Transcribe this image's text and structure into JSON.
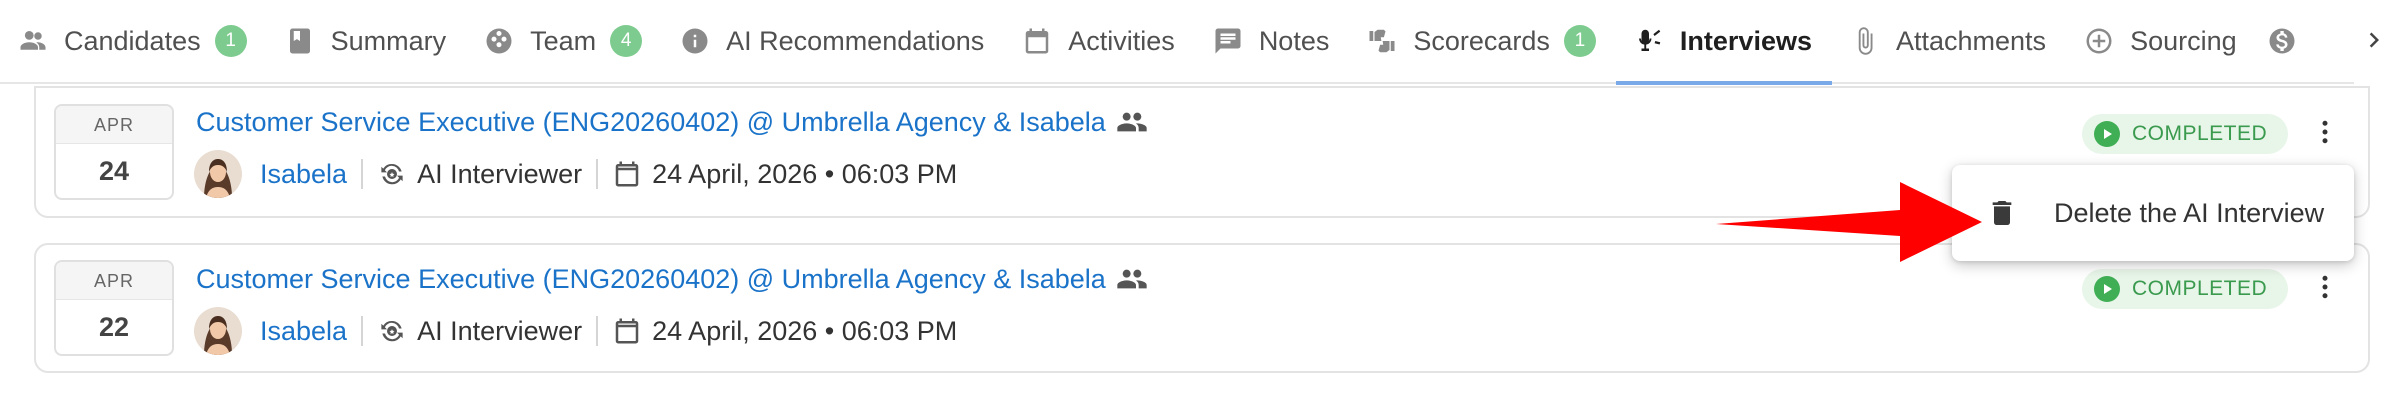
{
  "tabs": [
    {
      "label": "Candidates",
      "icon": "people-icon",
      "count": "1"
    },
    {
      "label": "Summary",
      "icon": "book-icon"
    },
    {
      "label": "Team",
      "icon": "team-icon",
      "count": "4"
    },
    {
      "label": "AI Recommendations",
      "icon": "info-icon"
    },
    {
      "label": "Activities",
      "icon": "calendar-icon"
    },
    {
      "label": "Notes",
      "icon": "comment-icon"
    },
    {
      "label": "Scorecards",
      "icon": "thumbs-icon",
      "count": "1"
    },
    {
      "label": "Interviews",
      "icon": "interview-icon",
      "active": true
    },
    {
      "label": "Attachments",
      "icon": "paperclip-icon"
    },
    {
      "label": "Sourcing",
      "icon": "add-circle-icon"
    },
    {
      "label": "",
      "icon": "dollar-icon"
    }
  ],
  "interviews": [
    {
      "month": "APR",
      "day": "24",
      "title": "Customer Service Executive (ENG20260402) @ Umbrella Agency & Isabela",
      "candidate": "Isabela",
      "type": "AI Interviewer",
      "datetime": "24 April, 2026 • 06:03 PM",
      "status": "COMPLETED"
    },
    {
      "month": "APR",
      "day": "22",
      "title": "Customer Service Executive (ENG20260402) @ Umbrella Agency & Isabela",
      "candidate": "Isabela",
      "type": "AI Interviewer",
      "datetime": "24 April, 2026 • 06:03 PM",
      "status": "COMPLETED"
    }
  ],
  "menu": {
    "delete_label": "Delete the AI Interview",
    "icon": "trash-icon"
  },
  "colors": {
    "link": "#1a73c9",
    "active_tab_underline": "#7aa9ea",
    "count_badge": "#7ecb8f",
    "status_bg": "#e8f5e9",
    "status_text": "#3a9a4e",
    "annotation_arrow": "#ff0000"
  }
}
